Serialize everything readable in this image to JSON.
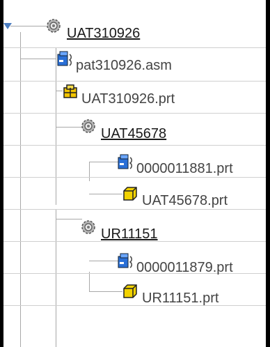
{
  "tree": {
    "items": [
      {
        "label": "UAT310926",
        "icon": "gear-icon",
        "linked": true
      },
      {
        "label": "pat310926.asm",
        "icon": "assembly-doc-icon",
        "linked": false
      },
      {
        "label": "UAT310926.prt",
        "icon": "part-assembly-icon",
        "linked": false
      },
      {
        "label": "UAT45678",
        "icon": "gear-icon",
        "linked": true
      },
      {
        "label": "0000011881.prt",
        "icon": "assembly-doc-icon",
        "linked": false
      },
      {
        "label": "UAT45678.prt",
        "icon": "yellow-cube-icon",
        "linked": false
      },
      {
        "label": "UR11151",
        "icon": "gear-icon",
        "linked": true
      },
      {
        "label": "0000011879.prt",
        "icon": "assembly-doc-icon",
        "linked": false
      },
      {
        "label": "UR11151.prt",
        "icon": "yellow-cube-icon",
        "linked": false
      }
    ]
  }
}
